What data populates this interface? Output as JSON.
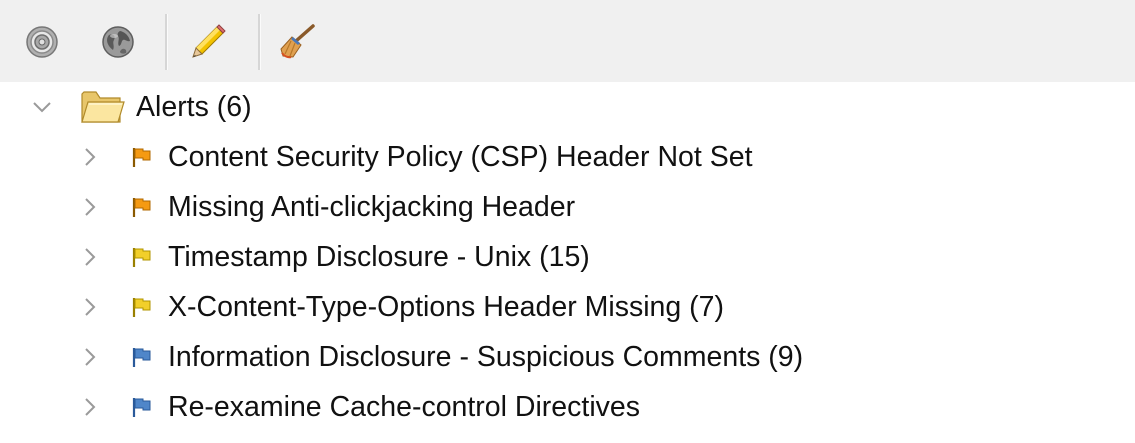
{
  "toolbar": {
    "buttons": [
      {
        "icon": "target-icon"
      },
      {
        "icon": "globe-icon"
      },
      {
        "icon": "pencil-icon"
      },
      {
        "icon": "broom-icon"
      }
    ]
  },
  "tree": {
    "root": {
      "label": "Alerts (6)",
      "icon": "folder-open-icon",
      "expanded": true
    },
    "alerts": [
      {
        "label": "Content Security Policy (CSP) Header Not Set",
        "risk": "medium",
        "flag_color": "#f59a12"
      },
      {
        "label": "Missing Anti-clickjacking Header",
        "risk": "medium",
        "flag_color": "#f59a12"
      },
      {
        "label": "Timestamp Disclosure - Unix (15)",
        "risk": "low",
        "flag_color": "#f2cf2a"
      },
      {
        "label": "X-Content-Type-Options Header Missing (7)",
        "risk": "low",
        "flag_color": "#f2cf2a"
      },
      {
        "label": "Information Disclosure - Suspicious Comments (9)",
        "risk": "informational",
        "flag_color": "#4f86c9"
      },
      {
        "label": "Re-examine Cache-control Directives",
        "risk": "informational",
        "flag_color": "#4f86c9"
      }
    ]
  }
}
